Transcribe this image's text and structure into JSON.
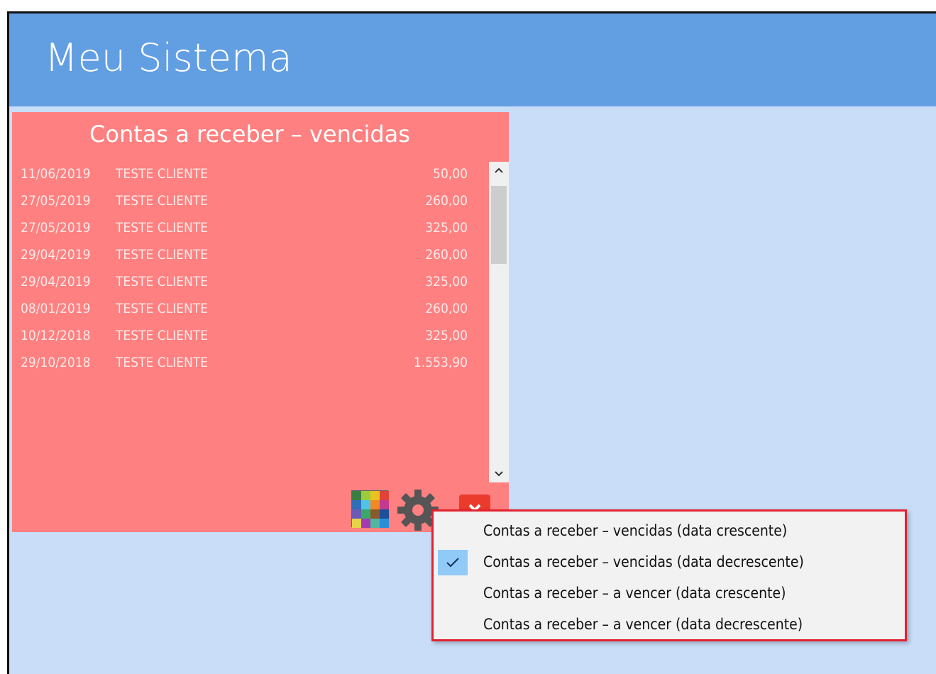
{
  "app": {
    "title": "Meu Sistema"
  },
  "tile": {
    "title": "Contas a receber – vencidas",
    "background": "#ff8080",
    "rows": [
      {
        "date": "11/06/2019",
        "client": "TESTE CLIENTE",
        "value": "50,00"
      },
      {
        "date": "27/05/2019",
        "client": "TESTE CLIENTE",
        "value": "260,00"
      },
      {
        "date": "27/05/2019",
        "client": "TESTE CLIENTE",
        "value": "325,00"
      },
      {
        "date": "29/04/2019",
        "client": "TESTE CLIENTE",
        "value": "260,00"
      },
      {
        "date": "29/04/2019",
        "client": "TESTE CLIENTE",
        "value": "325,00"
      },
      {
        "date": "08/01/2019",
        "client": "TESTE CLIENTE",
        "value": "260,00"
      },
      {
        "date": "10/12/2018",
        "client": "TESTE CLIENTE",
        "value": "325,00"
      },
      {
        "date": "29/10/2018",
        "client": "TESTE CLIENTE",
        "value": "1.553,90"
      }
    ],
    "toolbar": {
      "color_icon": "color-palette-icon",
      "settings_icon": "gear-icon",
      "close_icon": "close-icon"
    }
  },
  "menu": {
    "items": [
      {
        "label": "Contas a receber – vencidas (data crescente)",
        "checked": false
      },
      {
        "label": "Contas a receber – vencidas (data decrescente)",
        "checked": true
      },
      {
        "label": "Contas a receber – a vencer (data crescente)",
        "checked": false
      },
      {
        "label": "Contas a receber – a vencer (data decrescente)",
        "checked": false
      }
    ]
  },
  "colors": {
    "header": "#629ee2",
    "workspace": "#c9ddf8",
    "tile": "#ff8080",
    "menu_highlight_border": "#e22230",
    "check_background": "#91c9f7"
  }
}
